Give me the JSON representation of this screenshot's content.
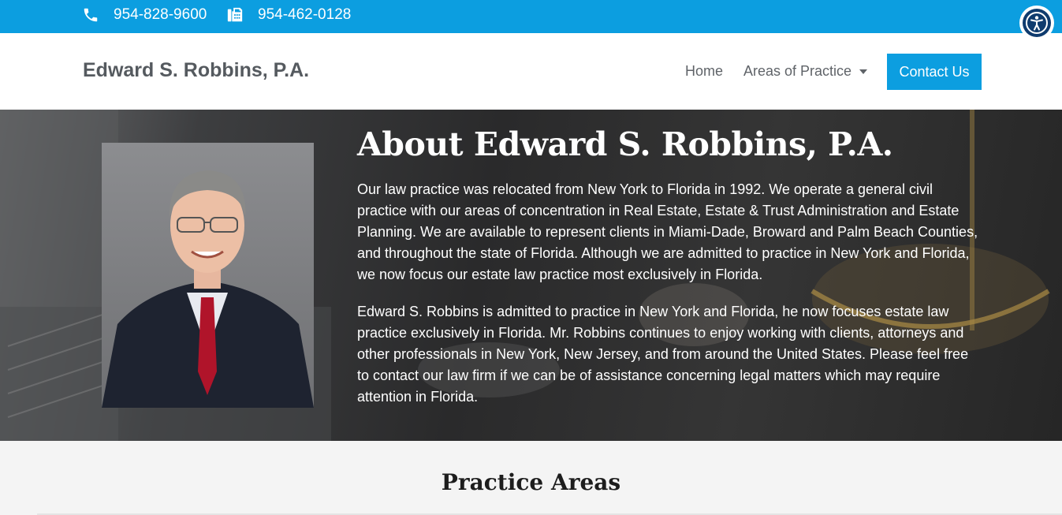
{
  "topbar": {
    "phone": "954-828-9600",
    "fax": "954-462-0128",
    "phone_icon": "phone-icon",
    "fax_icon": "fax-icon",
    "accessibility_icon": "accessibility-icon"
  },
  "header": {
    "site_title": "Edward S. Robbins, P.A.",
    "nav": {
      "home": "Home",
      "areas": "Areas of Practice",
      "contact": "Contact Us"
    }
  },
  "about": {
    "title": "About Edward S. Robbins, P.A.",
    "paragraphs": [
      "Our law practice was relocated from New York to Florida in 1992. We operate a general civil practice with our areas of concentration in Real Estate, Estate & Trust Administration and Estate Planning. We are available to represent clients in Miami-Dade, Broward and Palm Beach Counties, and throughout the state of Florida. Although we are admitted to practice in New York and Florida, we now focus our estate law practice most exclusively in Florida.",
      "Edward S. Robbins is admitted to practice in New York and Florida, he now focuses estate law practice exclusively in Florida. Mr. Robbins continues to enjoy working with clients, attorneys and other professionals in New York, New Jersey, and from around the United States. Please feel free to contact our law firm if we can be of assistance concerning legal matters which may require attention in Florida."
    ]
  },
  "practice": {
    "title": "Practice Areas"
  },
  "colors": {
    "accent": "#0c9ee0",
    "accessibility_bg": "#0f3b6e",
    "title_text": "#555a5f"
  }
}
